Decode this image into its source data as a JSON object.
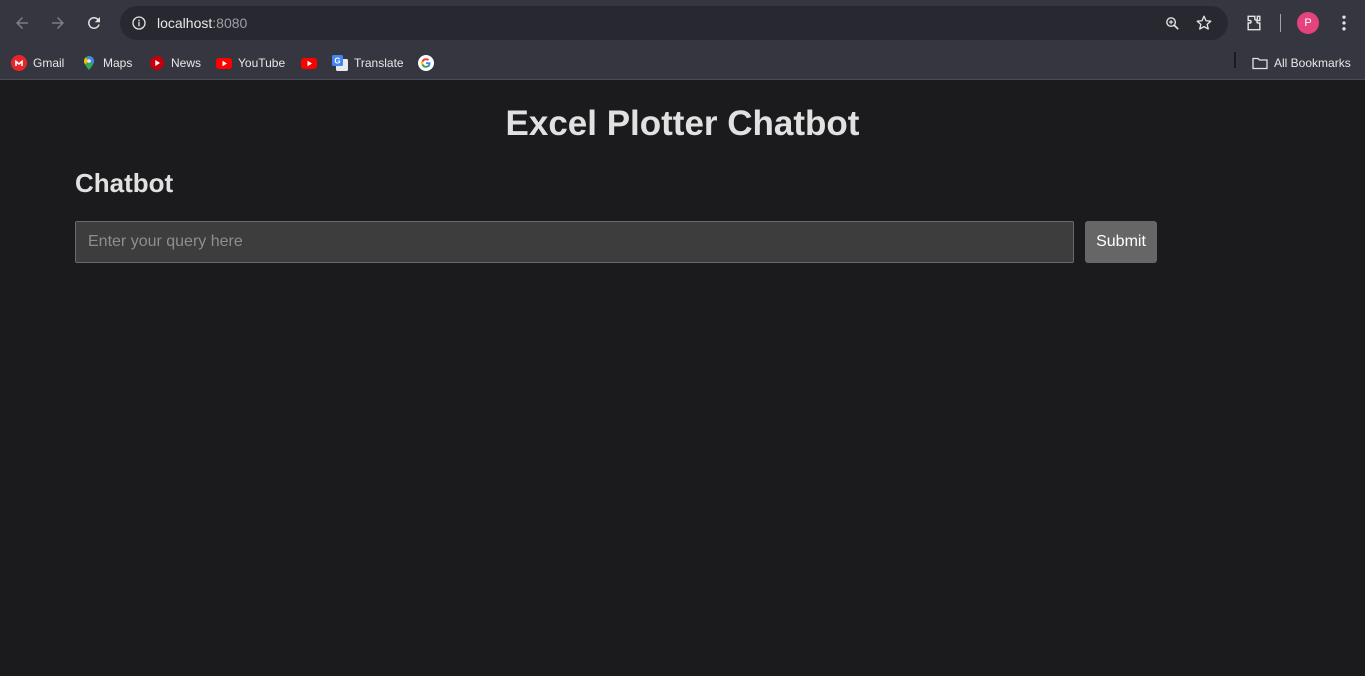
{
  "browser": {
    "url_host": "localhost",
    "url_port": ":8080",
    "profile_initial": "P",
    "bookmarks": [
      {
        "label": "Gmail",
        "icon": "gmail-icon"
      },
      {
        "label": "Maps",
        "icon": "maps-icon"
      },
      {
        "label": "News",
        "icon": "news-icon"
      },
      {
        "label": "YouTube",
        "icon": "youtube-icon"
      },
      {
        "label": "",
        "icon": "youtube-icon"
      },
      {
        "label": "Translate",
        "icon": "translate-icon"
      },
      {
        "label": "",
        "icon": "google-icon"
      }
    ],
    "all_bookmarks_label": "All Bookmarks"
  },
  "page": {
    "title": "Excel Plotter Chatbot",
    "section_title": "Chatbot",
    "query_placeholder": "Enter your query here",
    "query_value": "",
    "submit_label": "Submit"
  },
  "colors": {
    "page_background": "#1b1b1d",
    "chrome_background": "#35363f",
    "avatar": "#e5437d",
    "submit_button": "#666666"
  }
}
